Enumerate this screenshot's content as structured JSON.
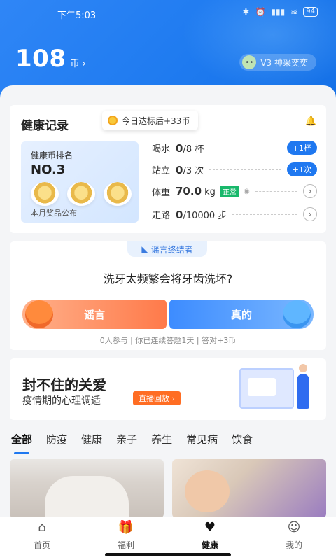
{
  "status_bar": {
    "time": "下午5:03",
    "battery": "94"
  },
  "header": {
    "coin_count": "108",
    "coin_unit": "币 ›",
    "vip_label": "V3 神采奕奕"
  },
  "health_record": {
    "title": "健康记录",
    "tip": "今日达标后+33币",
    "rank_label": "健康币排名",
    "rank_value": "NO.3",
    "rank_footer": "本月奖品公布",
    "items": [
      {
        "name": "喝水",
        "value": "0",
        "rest": "/8 杯",
        "action": "+1杯"
      },
      {
        "name": "站立",
        "value": "0",
        "rest": "/3 次",
        "action": "+1次"
      },
      {
        "name": "体重",
        "value": "70.0",
        "rest": " kg",
        "badge": "正常"
      },
      {
        "name": "走路",
        "value": "0",
        "rest": "/10000 步"
      }
    ]
  },
  "rumor": {
    "tag": "谣言终结者",
    "question": "洗牙太频繁会将牙齿洗坏?",
    "false_label": "谣言",
    "true_label": "真的",
    "stats": "0人参与 | 你已连续答题1天 | 答对+3币"
  },
  "banner": {
    "title": "封不住的关爱",
    "subtitle": "疫情期的心理调适",
    "live_button": "直播回放 ›"
  },
  "categories": [
    "全部",
    "防疫",
    "健康",
    "亲子",
    "养生",
    "常见病",
    "饮食"
  ],
  "tabbar": [
    {
      "label": "首页",
      "icon": "home-icon"
    },
    {
      "label": "福利",
      "icon": "gift-icon"
    },
    {
      "label": "健康",
      "icon": "heart-icon"
    },
    {
      "label": "我的",
      "icon": "smile-icon"
    }
  ],
  "colors": {
    "primary": "#1f78f0",
    "orange": "#ff7a4a",
    "green": "#19b86b"
  }
}
